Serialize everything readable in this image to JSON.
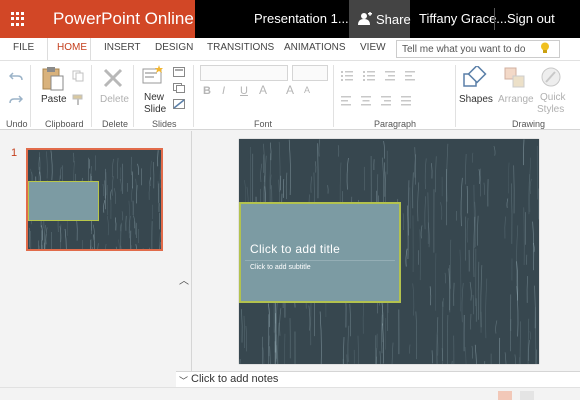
{
  "titlebar": {
    "app_name": "PowerPoint Online",
    "document_title": "Presentation 1...",
    "share_label": "Share",
    "user_name": "Tiffany Grace...",
    "signout_label": "Sign out"
  },
  "tabs": [
    {
      "label": "FILE",
      "active": false
    },
    {
      "label": "HOME",
      "active": true
    },
    {
      "label": "INSERT",
      "active": false
    },
    {
      "label": "DESIGN",
      "active": false
    },
    {
      "label": "TRANSITIONS",
      "active": false
    },
    {
      "label": "ANIMATIONS",
      "active": false
    },
    {
      "label": "VIEW",
      "active": false
    }
  ],
  "tell_me": {
    "placeholder": "Tell me what you want to do"
  },
  "ribbon": {
    "groups": {
      "undo": "Undo",
      "clipboard": "Clipboard",
      "delete": "Delete",
      "slides": "Slides",
      "font": "Font",
      "paragraph": "Paragraph",
      "drawing": "Drawing"
    },
    "buttons": {
      "paste": "Paste",
      "delete": "Delete",
      "new_slide_line1": "New",
      "new_slide_line2": "Slide",
      "shapes": "Shapes",
      "arrange": "Arrange",
      "quick_styles_line1": "Quick",
      "quick_styles_line2": "Styles"
    },
    "font_glyphs": {
      "bold": "B",
      "italic": "I",
      "underline": "U",
      "font_color": "A",
      "grow": "A",
      "shrink": "A"
    }
  },
  "slides_pane": {
    "slide_number": "1"
  },
  "slide": {
    "title_placeholder": "Click to add title",
    "subtitle_placeholder": "Click to add subtitle"
  },
  "notes": {
    "placeholder": "Click to add notes"
  },
  "colors": {
    "brand": "#d24726",
    "titlebar": "#000000",
    "slide_background": "#37474f",
    "title_box": "#7c9ba3",
    "title_border": "#b3c24e"
  }
}
